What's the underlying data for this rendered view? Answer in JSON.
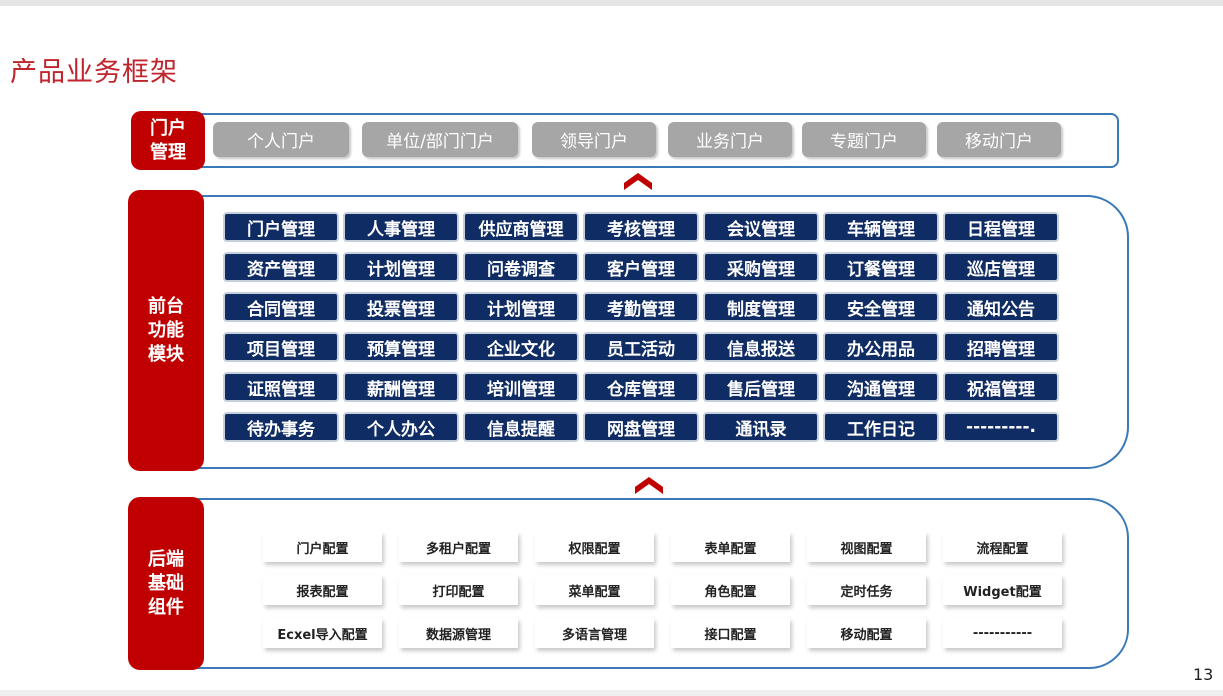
{
  "title": "产品业务框架",
  "page_number": "13",
  "portal_section": {
    "label": "门户\n管理",
    "items": [
      "个人门户",
      "单位/部门门户",
      "领导门户",
      "业务门户",
      "专题门户",
      "移动门户"
    ]
  },
  "front_section": {
    "label": "前台\n功能\n模块",
    "items": [
      "门户管理",
      "人事管理",
      "供应商管理",
      "考核管理",
      "会议管理",
      "车辆管理",
      "日程管理",
      "资产管理",
      "计划管理",
      "问卷调查",
      "客户管理",
      "采购管理",
      "订餐管理",
      "巡店管理",
      "合同管理",
      "投票管理",
      "计划管理",
      "考勤管理",
      "制度管理",
      "安全管理",
      "通知公告",
      "项目管理",
      "预算管理",
      "企业文化",
      "员工活动",
      "信息报送",
      "办公用品",
      "招聘管理",
      "证照管理",
      "薪酬管理",
      "培训管理",
      "仓库管理",
      "售后管理",
      "沟通管理",
      "祝福管理",
      "待办事务",
      "个人办公",
      "信息提醒",
      "网盘管理",
      "通讯录",
      "工作日记",
      "---------."
    ]
  },
  "back_section": {
    "label": "后端\n基础\n组件",
    "items": [
      "门户配置",
      "多租户配置",
      "权限配置",
      "表单配置",
      "视图配置",
      "流程配置",
      "报表配置",
      "打印配置",
      "菜单配置",
      "角色配置",
      "定时任务",
      "Widget配置",
      "Ecxel导入配置",
      "数据源管理",
      "多语言管理",
      "接口配置",
      "移动配置",
      "-----------"
    ]
  },
  "colors": {
    "title": "#c0242c",
    "section_label_bg": "#c00000",
    "frame_border": "#3a79b7",
    "portal_item_bg": "#a6a6a6",
    "front_item_bg": "#102c64",
    "arrow": "#c00000"
  },
  "icons": {
    "arrow": "double-chevron-up-icon"
  }
}
